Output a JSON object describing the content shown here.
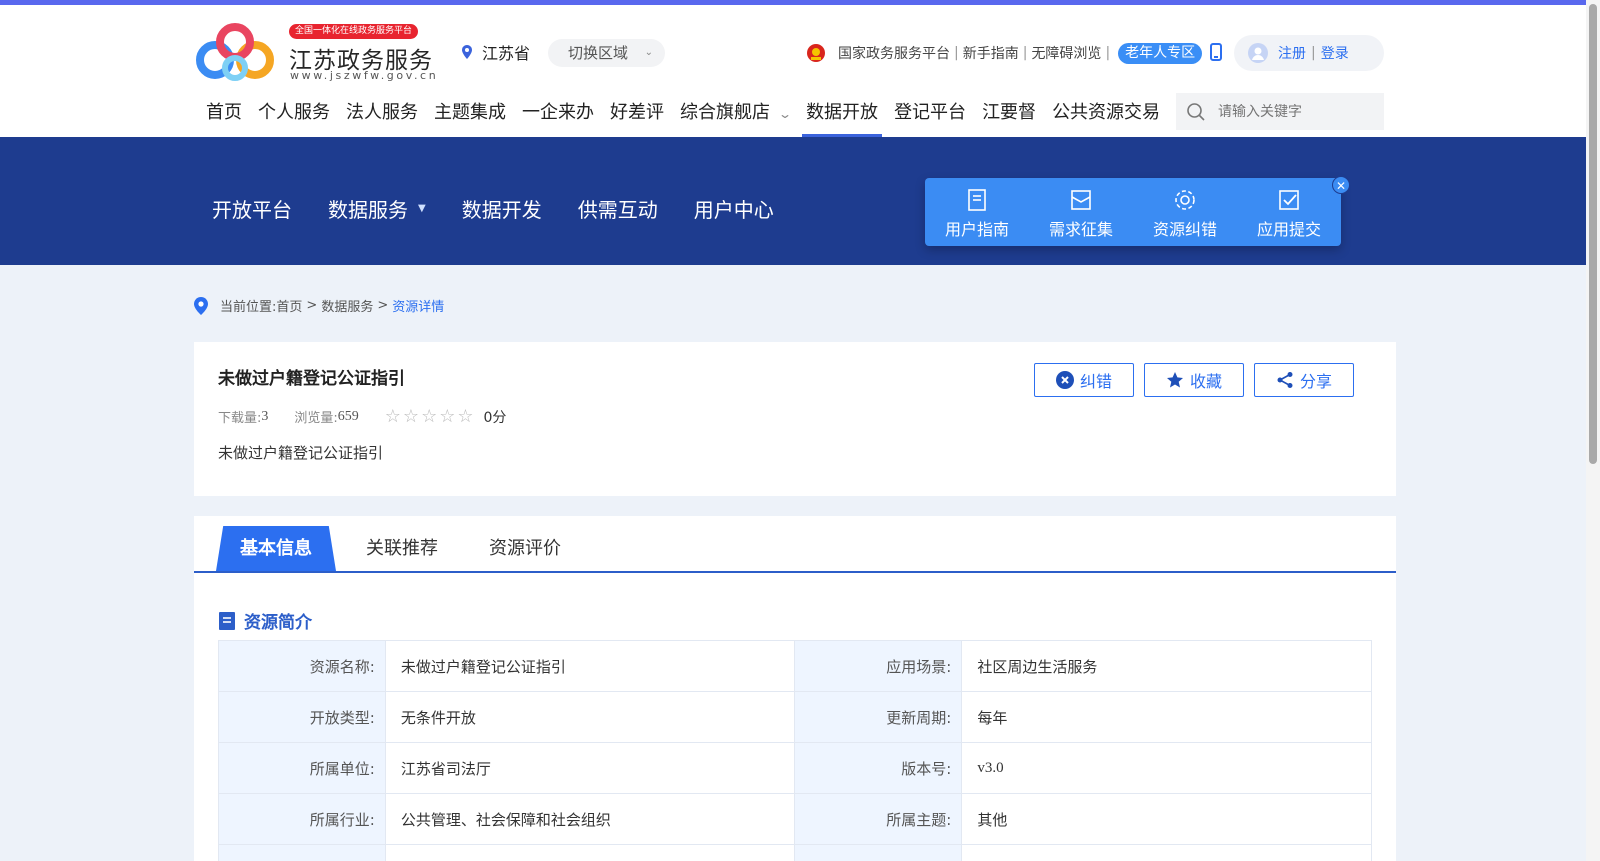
{
  "header": {
    "logo_badge": "全国一体化在线政务服务平台",
    "logo_name": "江苏政务服务",
    "logo_url": "www.jszwfw.gov.cn",
    "location": "江苏省",
    "switch_region": "切换区域",
    "links": [
      "国家政务服务平台",
      "新手指南",
      "无障碍浏览"
    ],
    "elder_zone": "老年人专区",
    "register": "注册",
    "login": "登录",
    "separator": "|",
    "nav": [
      "首页",
      "个人服务",
      "法人服务",
      "主题集成",
      "一企来办",
      "好差评",
      "综合旗舰店",
      "数据开放",
      "登记平台",
      "江要督",
      "公共资源交易"
    ],
    "active_nav": "数据开放",
    "search_placeholder": "请输入关键字"
  },
  "subnav": [
    "开放平台",
    "数据服务",
    "数据开发",
    "供需互动",
    "用户中心"
  ],
  "quick_actions": [
    "用户指南",
    "需求征集",
    "资源纠错",
    "应用提交"
  ],
  "breadcrumb": {
    "prefix": "当前位置:",
    "items": [
      "首页",
      "数据服务"
    ],
    "current": "资源详情",
    "sep": ">"
  },
  "resource": {
    "title": "未做过户籍登记公证指引",
    "downloads_label": "下载量:",
    "downloads": "3",
    "views_label": "浏览量:",
    "views": "659",
    "rating": 0,
    "score": "0分",
    "description": "未做过户籍登记公证指引",
    "buttons": {
      "correct": "纠错",
      "favorite": "收藏",
      "share": "分享"
    }
  },
  "tabs": [
    "基本信息",
    "关联推荐",
    "资源评价"
  ],
  "section_title": "资源简介",
  "info_rows": [
    {
      "k1": "资源名称:",
      "v1": "未做过户籍登记公证指引",
      "k2": "应用场景:",
      "v2": "社区周边生活服务"
    },
    {
      "k1": "开放类型:",
      "v1": "无条件开放",
      "k2": "更新周期:",
      "v2": "每年"
    },
    {
      "k1": "所属单位:",
      "v1": "江苏省司法厅",
      "k2": "版本号:",
      "v2": "v3.0"
    },
    {
      "k1": "所属行业:",
      "v1": "公共管理、社会保障和社会组织",
      "k2": "所属主题:",
      "v2": "其他"
    }
  ],
  "colors": {
    "primary": "#2c6ff0",
    "band": "#1e3c8f",
    "stripe": "#5968ee",
    "quick": "#3b8cf3"
  }
}
